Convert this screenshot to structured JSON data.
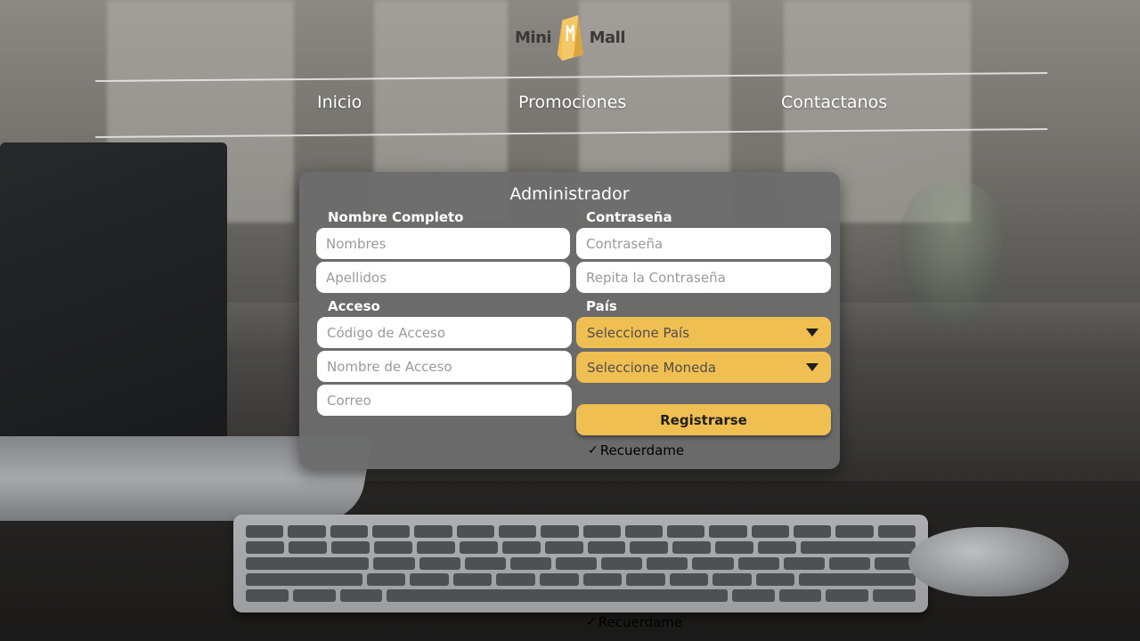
{
  "brand": {
    "left_word": "Mini",
    "right_word": "Mall",
    "mark_color": "#f0bf52"
  },
  "nav": {
    "items": [
      {
        "label": "Inicio"
      },
      {
        "label": "Promociones"
      },
      {
        "label": "Contactanos"
      }
    ]
  },
  "form": {
    "title": "Administrador",
    "sections": {
      "full_name_label": "Nombre Completo",
      "password_label": "Contraseña",
      "access_label": "Acceso",
      "country_label": "País"
    },
    "fields": {
      "first_names_placeholder": "Nombres",
      "last_names_placeholder": "Apellidos",
      "password_placeholder": "Contraseña",
      "repeat_password_placeholder": "Repita la Contraseña",
      "access_code_placeholder": "Código de Acceso",
      "access_name_placeholder": "Nombre de Acceso",
      "email_placeholder": "Correo"
    },
    "selects": {
      "country_selected": "Seleccione País",
      "currency_selected": "Seleccione Moneda"
    },
    "register_label": "Registrarse",
    "remember_label": "Recuerdame",
    "remember_checked": true
  },
  "footer": {
    "remember_label": "Recuerdame",
    "remember_checked": true
  },
  "colors": {
    "accent": "#f0bf52",
    "panel": "#6c6c6c",
    "text_light": "#ffffff"
  }
}
